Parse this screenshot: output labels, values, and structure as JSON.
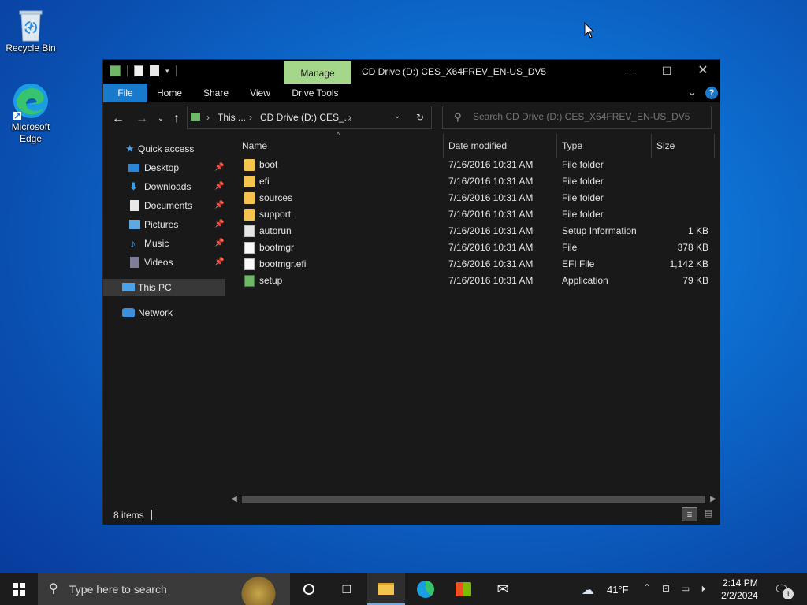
{
  "desktop": {
    "icons": [
      {
        "label": "Recycle Bin"
      },
      {
        "label": "Microsoft Edge"
      }
    ]
  },
  "window": {
    "manage_tab": "Manage",
    "title": "CD Drive (D:) CES_X64FREV_EN-US_DV5",
    "ribbon_tabs": [
      "File",
      "Home",
      "Share",
      "View",
      "Drive Tools"
    ],
    "address": {
      "segments": [
        "This ...",
        "CD Drive (D:) CES_..."
      ]
    },
    "search": {
      "placeholder": "Search CD Drive (D:) CES_X64FREV_EN-US_DV5"
    },
    "nav": {
      "quick_access": "Quick access",
      "items": [
        {
          "label": "Desktop",
          "icon": "desktop-icon"
        },
        {
          "label": "Downloads",
          "icon": "downloads-icon"
        },
        {
          "label": "Documents",
          "icon": "documents-icon"
        },
        {
          "label": "Pictures",
          "icon": "pictures-icon"
        },
        {
          "label": "Music",
          "icon": "music-icon"
        },
        {
          "label": "Videos",
          "icon": "videos-icon"
        }
      ],
      "this_pc": "This PC",
      "network": "Network"
    },
    "columns": [
      "Name",
      "Date modified",
      "Type",
      "Size"
    ],
    "files": [
      {
        "name": "boot",
        "date": "7/16/2016 10:31 AM",
        "type": "File folder",
        "size": "",
        "icon": "folder-icon"
      },
      {
        "name": "efi",
        "date": "7/16/2016 10:31 AM",
        "type": "File folder",
        "size": "",
        "icon": "folder-icon"
      },
      {
        "name": "sources",
        "date": "7/16/2016 10:31 AM",
        "type": "File folder",
        "size": "",
        "icon": "folder-icon"
      },
      {
        "name": "support",
        "date": "7/16/2016 10:31 AM",
        "type": "File folder",
        "size": "",
        "icon": "folder-icon"
      },
      {
        "name": "autorun",
        "date": "7/16/2016 10:31 AM",
        "type": "Setup Information",
        "size": "1 KB",
        "icon": "setup-info-icon"
      },
      {
        "name": "bootmgr",
        "date": "7/16/2016 10:31 AM",
        "type": "File",
        "size": "378 KB",
        "icon": "file-icon"
      },
      {
        "name": "bootmgr.efi",
        "date": "7/16/2016 10:31 AM",
        "type": "EFI File",
        "size": "1,142 KB",
        "icon": "file-icon"
      },
      {
        "name": "setup",
        "date": "7/16/2016 10:31 AM",
        "type": "Application",
        "size": "79 KB",
        "icon": "setup-app-icon"
      }
    ],
    "status": "8 items"
  },
  "taskbar": {
    "search_placeholder": "Type here to search",
    "weather": "41°F",
    "time": "2:14 PM",
    "date": "2/2/2024",
    "notification_count": "1"
  },
  "colors": {
    "accent": "#1979ca",
    "manage_tab": "#a5d78a",
    "folder": "#f5c44e"
  }
}
